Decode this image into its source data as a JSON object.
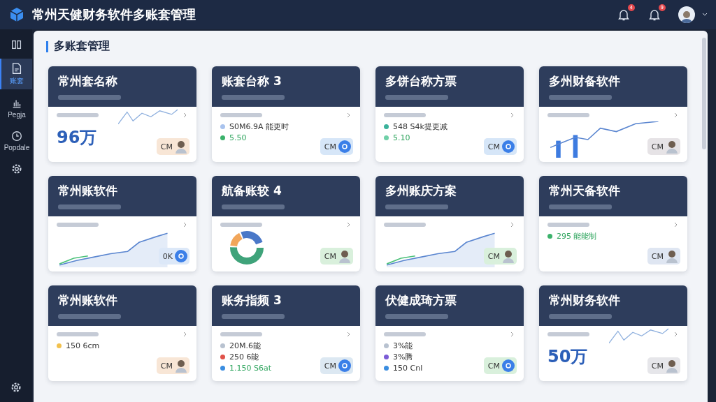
{
  "app_title": "常州天健财务软件多账套管理",
  "notifications": [
    {
      "count": "4"
    },
    {
      "count": "9"
    }
  ],
  "sidebar": {
    "items": [
      {
        "selected": false
      },
      {
        "label": "账套",
        "selected": true
      },
      {
        "label": "Pegja",
        "selected": false
      },
      {
        "label": "Popdale",
        "selected": false
      },
      {
        "selected": false
      }
    ]
  },
  "page_title": "多账套管理",
  "cards": [
    {
      "title": "常州套名称",
      "kind": "stat",
      "value": "96万",
      "badge": {
        "text": "CM",
        "color": "#f8e6d6",
        "kind": "avatar"
      }
    },
    {
      "title": "账套台称 3",
      "kind": "list",
      "rows": [
        {
          "text": "S0M6.9A 能更时",
          "color": "#a9c3ee",
          "kind": "item"
        },
        {
          "text": "5.50",
          "color": "#3bb26b",
          "kind": "value"
        }
      ],
      "badge": {
        "text": "CM",
        "color": "#d6e6f8",
        "kind": "dot"
      }
    },
    {
      "title": "多饼台称方票",
      "kind": "list",
      "rows": [
        {
          "text": "548 S4k提更减",
          "color": "#3bb29b",
          "kind": "item"
        },
        {
          "text": "5.10",
          "color": "#6fd0a8",
          "kind": "value"
        }
      ],
      "badge": {
        "text": "CM",
        "color": "#d6e6f8",
        "kind": "dot"
      }
    },
    {
      "title": "多州财备软件",
      "kind": "bars",
      "badge": {
        "text": "CM",
        "color": "#e6e3e6",
        "kind": "avatar"
      }
    },
    {
      "title": "常州账软件",
      "kind": "line",
      "badge": {
        "text": "0K",
        "color": "#dce8f8",
        "kind": "dot"
      }
    },
    {
      "title": "航备账较 4",
      "kind": "donut",
      "badge": {
        "text": "CM",
        "color": "#d9f0dc",
        "kind": "avatar"
      }
    },
    {
      "title": "多州账庆方案",
      "kind": "line",
      "badge": {
        "text": "CM",
        "color": "#d9f0dc",
        "kind": "avatar"
      }
    },
    {
      "title": "常州天备软件",
      "kind": "list",
      "rows": [
        {
          "text": "295 能能制",
          "color": "#3bb26b",
          "kind": "value"
        }
      ],
      "badge": {
        "text": "CM",
        "color": "#dfe6f2",
        "kind": "avatar"
      }
    },
    {
      "title": "常州账软件",
      "kind": "list",
      "rows": [
        {
          "text": "150 6cm",
          "color": "#f2c14e",
          "kind": "item"
        }
      ],
      "badge": {
        "text": "CM",
        "color": "#f8e6d6",
        "kind": "avatar"
      }
    },
    {
      "title": "账务指频 3",
      "kind": "list",
      "rows": [
        {
          "text": "20M.6能",
          "color": "#b8c2d0",
          "kind": "item"
        },
        {
          "text": "250 6能",
          "color": "#e0524a",
          "kind": "item"
        },
        {
          "text": "1.150 S6at",
          "color": "#3a8de0",
          "kind": "value"
        }
      ],
      "badge": {
        "text": "CM",
        "color": "#dce8f2",
        "kind": "dot"
      }
    },
    {
      "title": "伏健成琦方票",
      "kind": "list",
      "rows": [
        {
          "text": "3%能",
          "color": "#b8c2d0",
          "kind": "item"
        },
        {
          "text": "3%腾",
          "color": "#7b5cd6",
          "kind": "item"
        },
        {
          "text": "150 Cnl",
          "color": "#3a8de0",
          "kind": "item"
        }
      ],
      "badge": {
        "text": "CM",
        "color": "#d9f0dc",
        "kind": "dot"
      }
    },
    {
      "title": "常州财务软件",
      "kind": "stat",
      "value": "50万",
      "badge": {
        "text": "CM",
        "color": "#e6e6ea",
        "kind": "avatar"
      }
    }
  ]
}
